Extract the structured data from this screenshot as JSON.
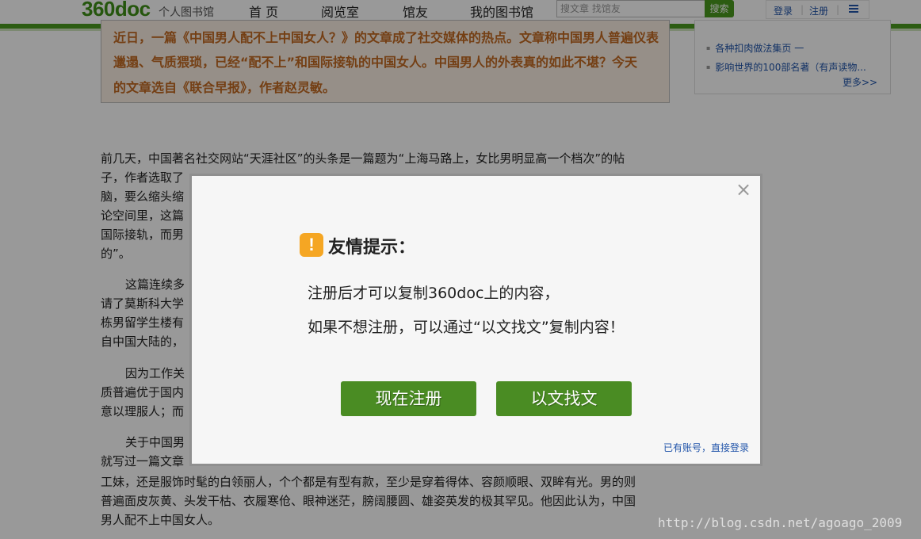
{
  "header": {
    "logo": "360doc",
    "logo_sub": "个人图书馆",
    "nav": [
      "首 页",
      "阅览室",
      "馆友",
      "我的图书馆"
    ],
    "search_placeholder": "搜文章 找馆友",
    "search_button": "搜索",
    "login": "登录",
    "register": "注册",
    "menu_icon": "list-icon",
    "accent_color": "#4a9a1e"
  },
  "article": {
    "intro_lines": [
      "近日，一篇《中国男人配不上中国女人？》的文章成了社交媒体的热点。文章称中国男人普遍仪表",
      "邋遢、气质猥琐，已经“配不上”和国际接轨的中国女人。中国男人的外表真的如此不堪？今天",
      "的文章选自《联合早报》，作者赵灵敏。"
    ],
    "paragraphs": [
      "前几天，中国著名社交网站“天涯社区”的头条是一篇题为“上海马路上，女比男明显高一个档次”的帖",
      "子，作者选取了",
      "脑，要么缩头缩",
      "论空间里，这篇",
      "国际接轨，而男",
      "的”。",
      "这篇连续多",
      "请了莫斯科大学",
      "栋男留学生楼有",
      "自中国大陆的，",
      "因为工作关",
      "质普遍优于国内",
      "意以理服人；而",
      "关于中国男",
      "就写过一篇文章",
      "工妹，还是服饰时髦的白领丽人，个个都是有型有款，至少是穿着得体、容颜顺眼、双眸有光。男的则",
      "普遍面皮灰黄、头发干枯、衣履寒伧、眼神迷茫，膀阔腰圆、雄姿英发的极其罕见。他因此认为，中国",
      "男人配不上中国女人。"
    ]
  },
  "sidebar": {
    "items": [
      "各种扣肉做法集页 一",
      "影响世界的100部名著（有声读物..."
    ],
    "more": "更多>>"
  },
  "modal": {
    "title": "友情提示：",
    "icon": "warning-icon",
    "line1": "注册后才可以复制360doc上的内容，",
    "line2": "如果不想注册，可以通过“以文找文”复制内容！",
    "register_button": "现在注册",
    "find_button": "以文找文",
    "login_link": "已有账号，直接登录",
    "close": "×"
  },
  "watermark": "http://blog.csdn.net/agoago_2009"
}
